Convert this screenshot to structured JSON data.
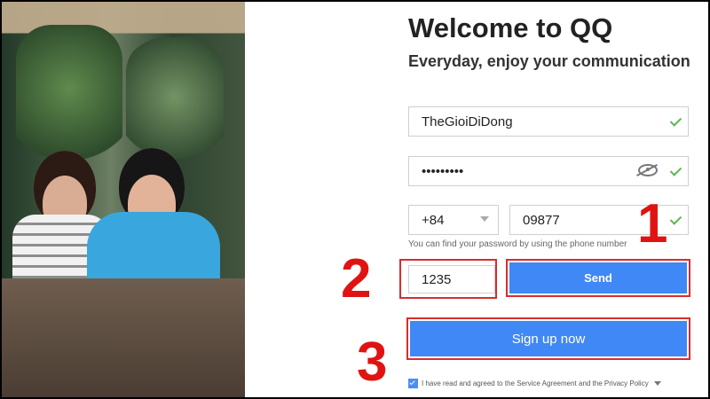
{
  "header": {
    "title": "Welcome to QQ",
    "subtitle": "Everyday, enjoy your communication"
  },
  "form": {
    "username": "TheGioiDiDong",
    "password": "•••••••••",
    "country_code": "+84",
    "phone": "09877",
    "phone_hint": "You can find your password by using the phone number",
    "verification_code": "1235",
    "send_label": "Send",
    "submit_label": "Sign up now",
    "agreement": "I have read and agreed to the Service Agreement and the Privacy Policy"
  },
  "annotations": {
    "badge_1": "1",
    "badge_2": "2",
    "badge_3": "3"
  },
  "icons": {
    "check": "check-icon",
    "eye": "eye-off-icon",
    "dropdown": "chevron-down-icon"
  },
  "colors": {
    "primary": "#4088f5",
    "success": "#5bb852",
    "annotation": "#e01313"
  }
}
